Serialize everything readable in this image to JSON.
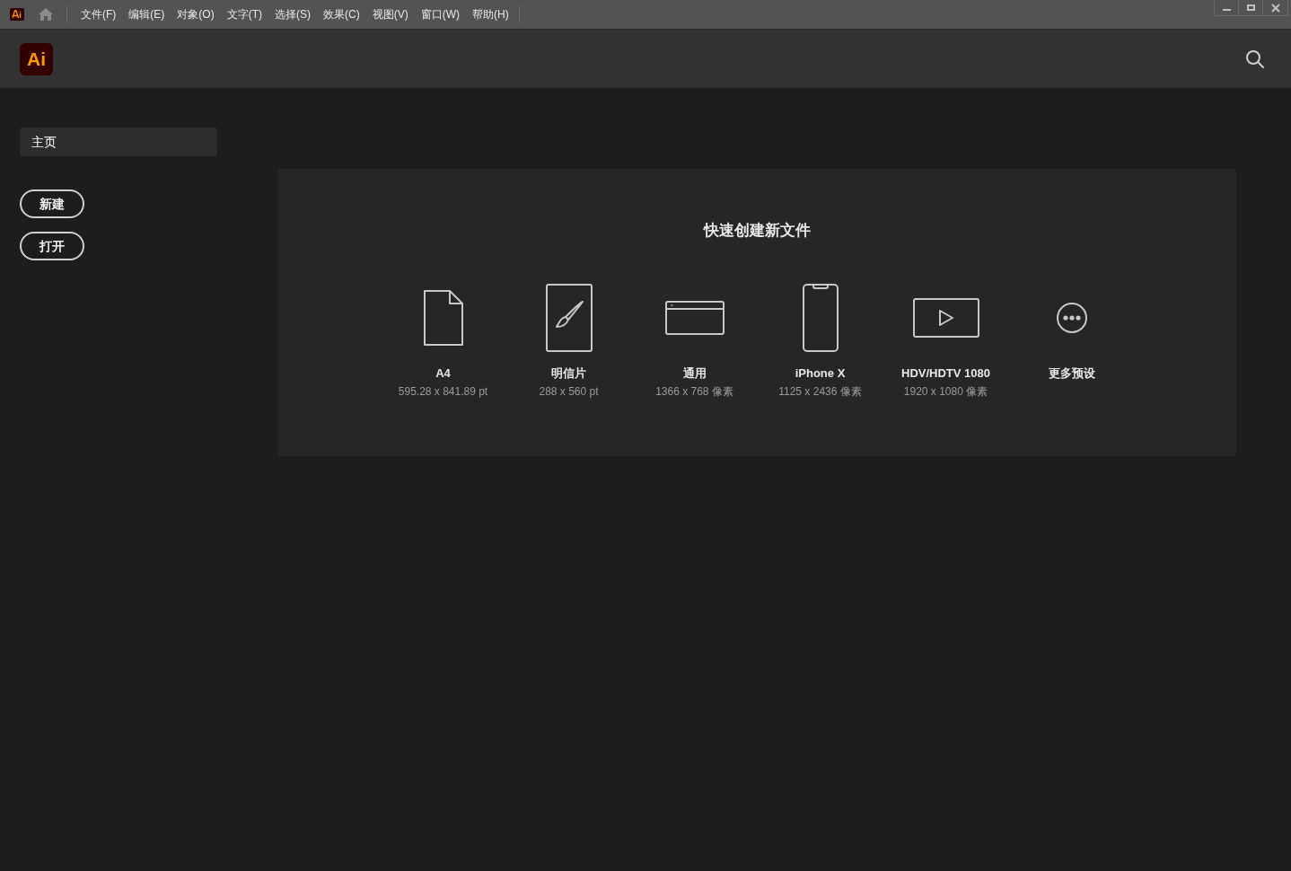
{
  "menu_bar": {
    "items": [
      "文件(F)",
      "编辑(E)",
      "对象(O)",
      "文字(T)",
      "选择(S)",
      "效果(C)",
      "视图(V)",
      "窗口(W)",
      "帮助(H)"
    ]
  },
  "header": {
    "logo": "Ai"
  },
  "sidebar": {
    "items": [
      {
        "label": "主页",
        "selected": true
      }
    ],
    "buttons": [
      "新建",
      "打开"
    ]
  },
  "quick_create": {
    "title": "快速创建新文件",
    "presets": [
      {
        "kind": "document",
        "name": "A4",
        "size": "595.28 x 841.89 pt"
      },
      {
        "kind": "brush",
        "name": "明信片",
        "size": "288 x 560 pt"
      },
      {
        "kind": "browser",
        "name": "通用",
        "size": "1366 x 768 像素"
      },
      {
        "kind": "phone",
        "name": "iPhone X",
        "size": "1125 x 2436 像素"
      },
      {
        "kind": "video",
        "name": "HDV/HDTV 1080",
        "size": "1920 x 1080 像素"
      },
      {
        "kind": "more",
        "name": "更多预设"
      }
    ]
  }
}
